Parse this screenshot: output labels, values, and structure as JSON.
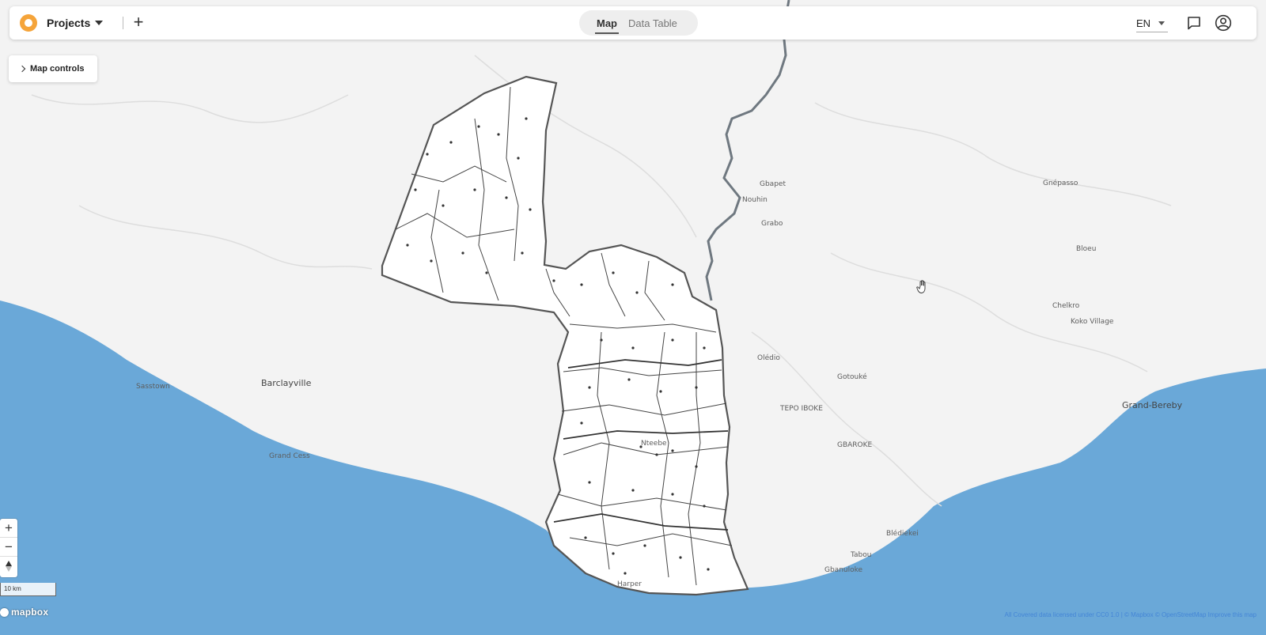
{
  "header": {
    "projects_label": "Projects",
    "add_label": "+",
    "tabs": [
      {
        "label": "Map",
        "active": true
      },
      {
        "label": "Data Table",
        "active": false
      }
    ],
    "language": "EN"
  },
  "map_controls": {
    "label": "Map controls"
  },
  "zoom": {
    "in_label": "+",
    "out_label": "−"
  },
  "scale": {
    "label": "10 km"
  },
  "mapbox_logo": "mapbox",
  "attribution": "All Covered data licensed under CC0 1.0 | © Mapbox © OpenStreetMap Improve this map",
  "places": {
    "gbapet": "Gbapet",
    "nouhin": "Nouhin",
    "grabo": "Grabo",
    "gnepasso": "Gnépasso",
    "bloeu": "Bloeu",
    "chelkro": "Chelkro",
    "koko_village": "Koko Village",
    "oledio": "Olédio",
    "gotouke": "Gotouké",
    "tepo_iboke": "TEPO IBOKE",
    "gbaroke": "GBAROKE",
    "grand_berebu": "Grand-Bereby",
    "sasstown": "Sasstown",
    "barclayville": "Barclayville",
    "grand_cess": "Grand Cess",
    "nteebe": "Nteebe",
    "tabou": "Tabou",
    "gbanuloke": "Gbanuloke",
    "blediekei": "Blédiekei",
    "harper": "Harper"
  },
  "colors": {
    "land": "#f3f3f3",
    "ocean": "#6aa8d8",
    "border": "#777777",
    "accent": "#f5a43a"
  },
  "icons": {
    "logo": "app-logo-icon",
    "chat": "chat-icon",
    "user": "user-account-icon",
    "compass": "compass-icon",
    "cursor": "hand-cursor-icon"
  }
}
